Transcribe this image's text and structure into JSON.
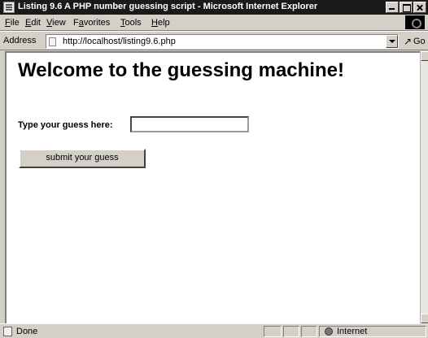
{
  "window": {
    "title": "Listing 9.6 A PHP number guessing script - Microsoft Internet Explorer"
  },
  "menu": {
    "items": [
      {
        "label": "File",
        "key": "F",
        "rest": "ile"
      },
      {
        "label": "Edit",
        "key": "E",
        "rest": "dit"
      },
      {
        "label": "View",
        "key": "V",
        "rest": "iew"
      },
      {
        "label": "Favorites",
        "key": "a",
        "pre": "F",
        "rest": "vorites"
      },
      {
        "label": "Tools",
        "key": "T",
        "rest": "ools"
      },
      {
        "label": "Help",
        "key": "H",
        "rest": "elp"
      }
    ]
  },
  "address": {
    "label": "Address",
    "url": "http://localhost/listing9.6.php",
    "go_label": "Go"
  },
  "page": {
    "heading": "Welcome to the guessing machine!",
    "guess_label": "Type your guess here:",
    "guess_value": "",
    "submit_label": "submit your guess"
  },
  "status": {
    "text": "Done",
    "zone": "Internet"
  },
  "icons": {
    "app": "ie-page-icon",
    "go": "go-arrow-icon",
    "zone": "internet-globe-icon"
  }
}
